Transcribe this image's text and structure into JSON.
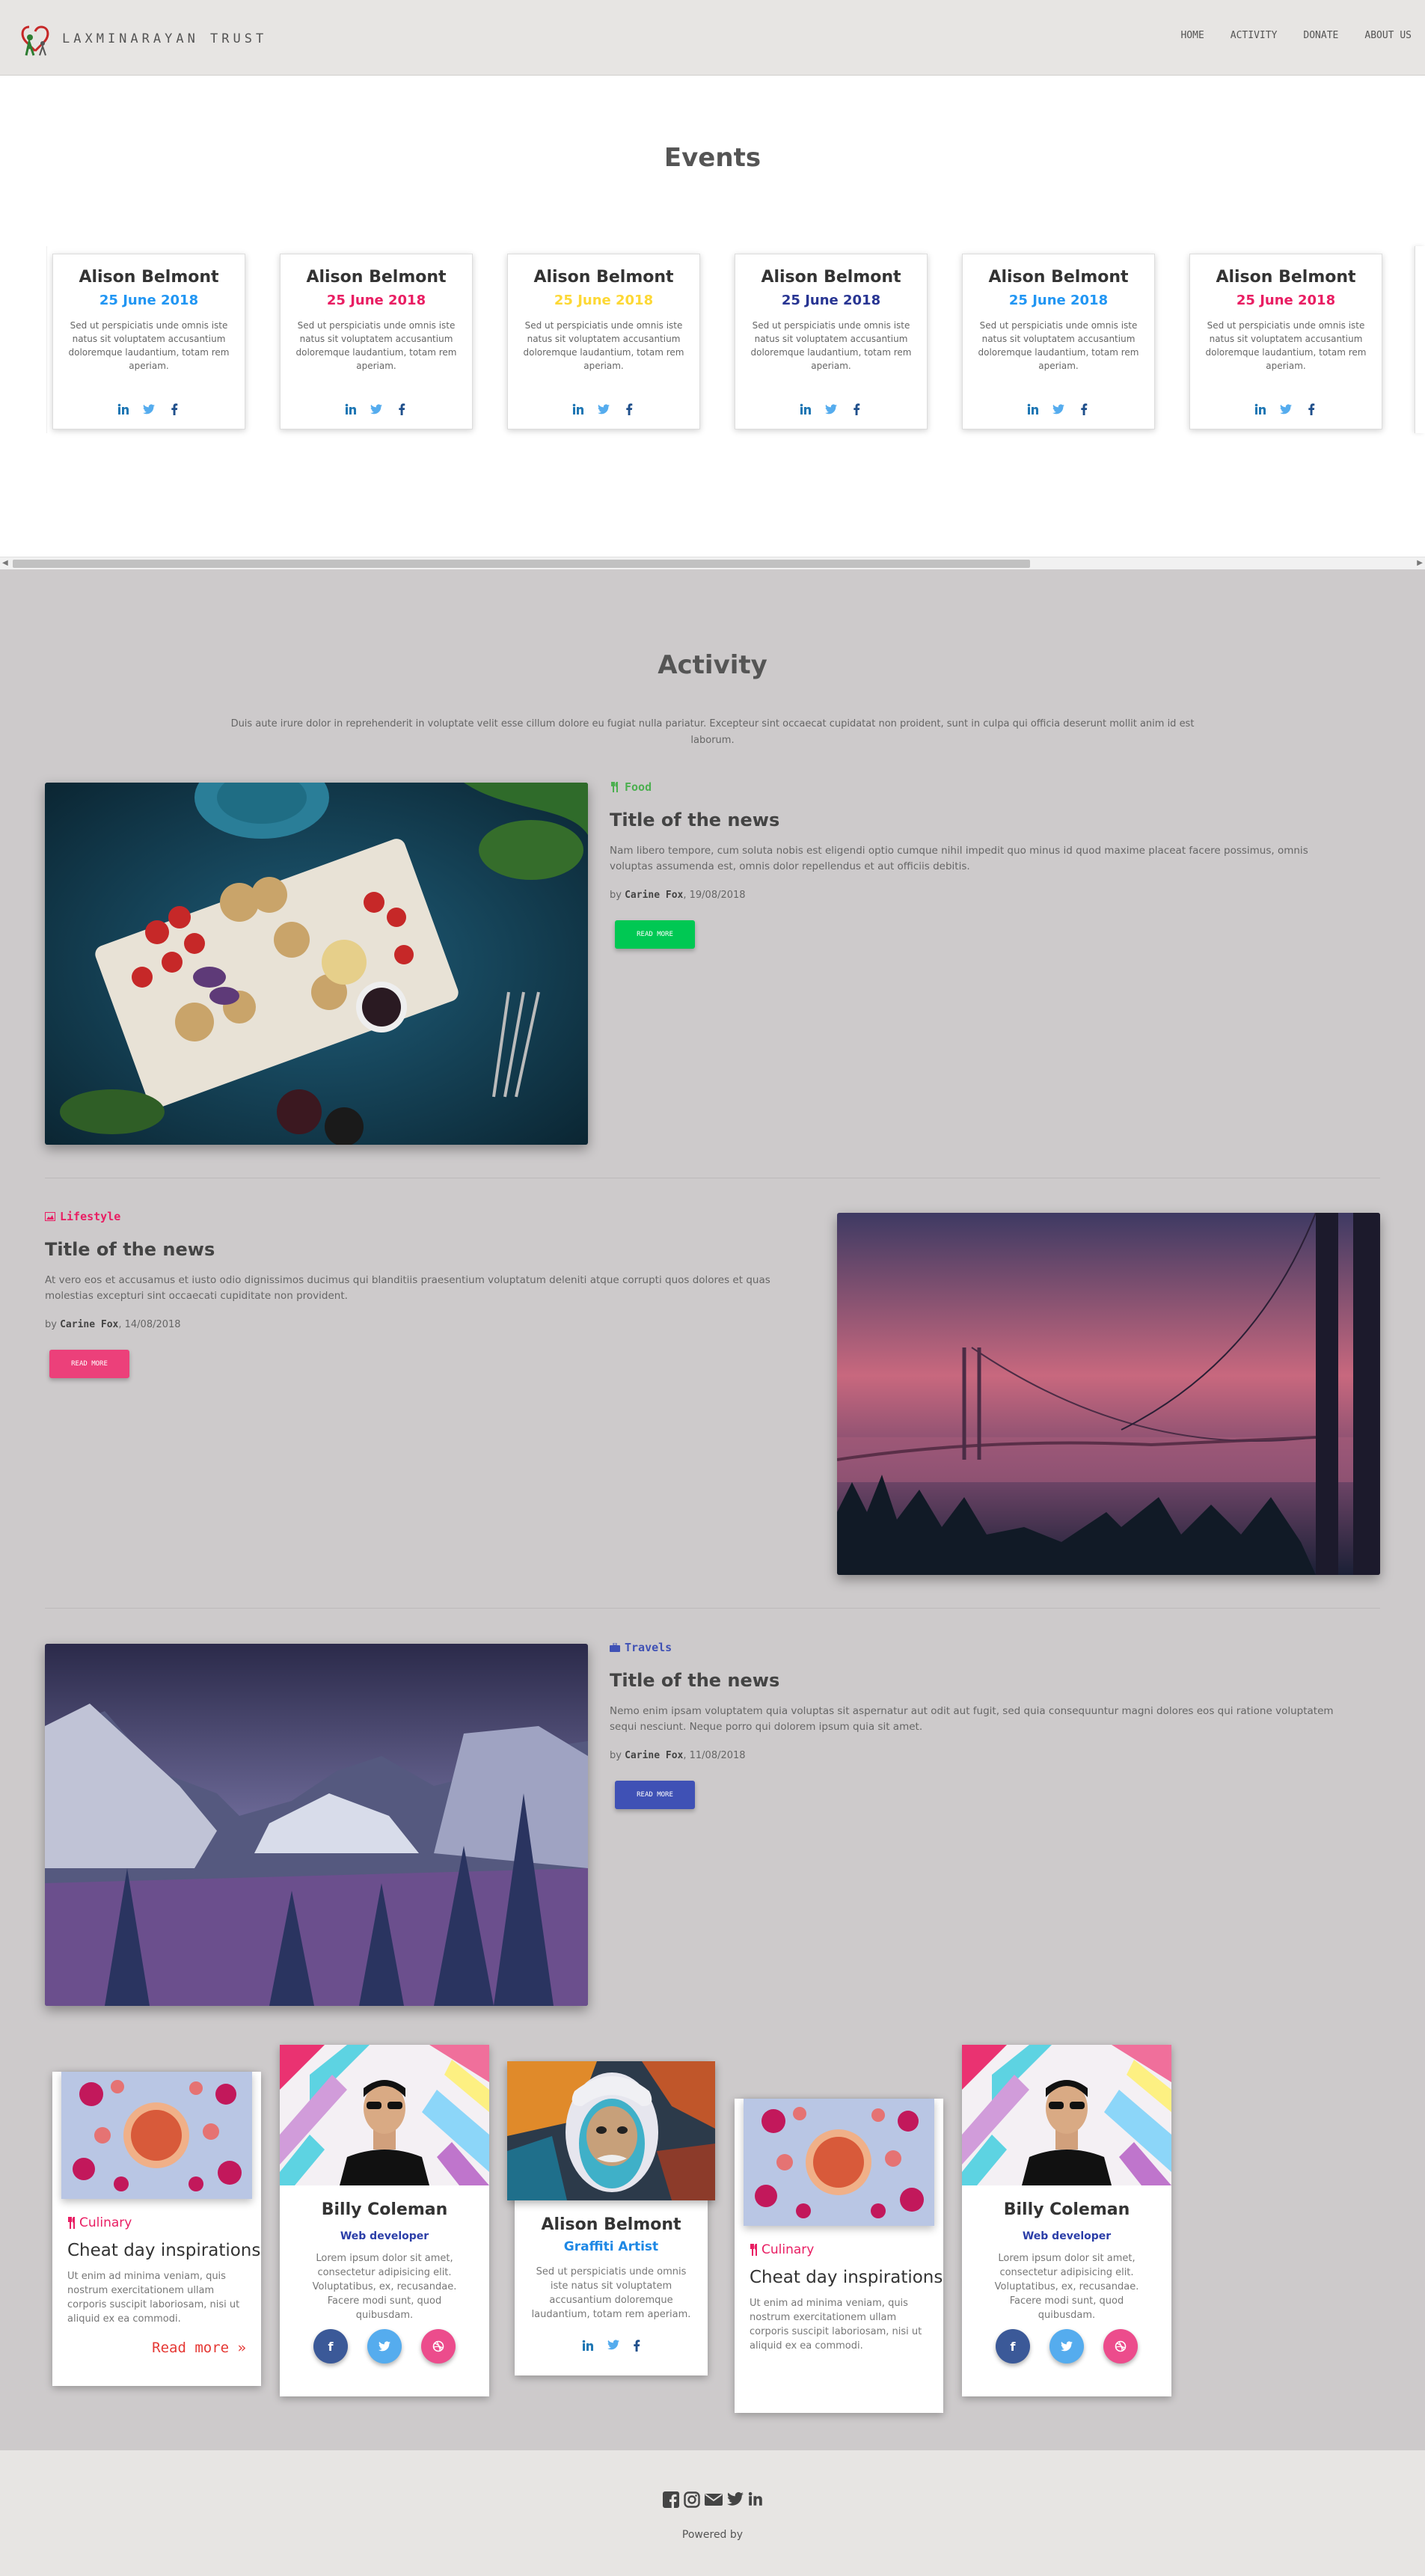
{
  "nav": {
    "brand": "LAXMINARAYAN TRUST",
    "menu": [
      "HOME",
      "ACTIVITY",
      "DONATE",
      "ABOUT US"
    ]
  },
  "events": {
    "title": "Events",
    "cards": [
      {
        "name": "Alison Belmont",
        "date": "25 June 2018",
        "date_color": "#2196f3",
        "text": "Sed ut perspiciatis unde omnis iste natus sit voluptatem accusantium doloremque laudantium, totam rem aperiam."
      },
      {
        "name": "Alison Belmont",
        "date": "25 June 2018",
        "date_color": "#e91e63",
        "text": "Sed ut perspiciatis unde omnis iste natus sit voluptatem accusantium doloremque laudantium, totam rem aperiam."
      },
      {
        "name": "Alison Belmont",
        "date": "25 June 2018",
        "date_color": "#fdd835",
        "text": "Sed ut perspiciatis unde omnis iste natus sit voluptatem accusantium doloremque laudantium, totam rem aperiam."
      },
      {
        "name": "Alison Belmont",
        "date": "25 June 2018",
        "date_color": "#283593",
        "text": "Sed ut perspiciatis unde omnis iste natus sit voluptatem accusantium doloremque laudantium, totam rem aperiam."
      },
      {
        "name": "Alison Belmont",
        "date": "25 June 2018",
        "date_color": "#2196f3",
        "text": "Sed ut perspiciatis unde omnis iste natus sit voluptatem accusantium doloremque laudantium, totam rem aperiam."
      },
      {
        "name": "Alison Belmont",
        "date": "25 June 2018",
        "date_color": "#e91e63",
        "text": "Sed ut perspiciatis unde omnis iste natus sit voluptatem accusantium doloremque laudantium, totam rem aperiam."
      }
    ],
    "social_icons": [
      "linkedin-icon",
      "twitter-icon",
      "facebook-icon"
    ]
  },
  "activity": {
    "title": "Activity",
    "lead": "Duis aute irure dolor in reprehenderit in voluptate velit esse cillum dolore eu fugiat nulla pariatur. Excepteur sint occaecat cupidatat non proident, sunt in culpa qui officia deserunt mollit anim id est laborum.",
    "news": [
      {
        "category": "Food",
        "category_color": "#4caf50",
        "title": "Title of the news",
        "text": "Nam libero tempore, cum soluta nobis est eligendi optio cumque nihil impedit quo minus id quod maxime placeat facere possimus, omnis voluptas assumenda est, omnis dolor repellendus et aut officiis debitis.",
        "by": "by",
        "author": "Carine Fox",
        "date": ", 19/08/2018",
        "button": "READ MORE",
        "button_color": "#00c853"
      },
      {
        "category": "Lifestyle",
        "category_color": "#e91e63",
        "title": "Title of the news",
        "text": "At vero eos et accusamus et iusto odio dignissimos ducimus qui blanditiis praesentium voluptatum deleniti atque corrupti quos dolores et quas molestias excepturi sint occaecati cupiditate non provident.",
        "by": "by",
        "author": "Carine Fox",
        "date": ", 14/08/2018",
        "button": "READ MORE",
        "button_color": "#ec407a"
      },
      {
        "category": "Travels",
        "category_color": "#3f51b5",
        "title": "Title of the news",
        "text": "Nemo enim ipsam voluptatem quia voluptas sit aspernatur aut odit aut fugit, sed quia consequuntur magni dolores eos qui ratione voluptatem sequi nesciunt. Neque porro qui dolorem ipsum quia sit amet.",
        "by": "by",
        "author": "Carine Fox",
        "date": ", 11/08/2018",
        "button": "READ MORE",
        "button_color": "#3f51b5"
      }
    ]
  },
  "cards": {
    "culinary1": {
      "category": "Culinary",
      "title": "Cheat day inspirations",
      "text": "Ut enim ad minima veniam, quis nostrum exercitationem ullam corporis suscipit laboriosam, nisi ut aliquid ex ea commodi.",
      "read_more": "Read more"
    },
    "profile1": {
      "name": "Billy Coleman",
      "role": "Web developer",
      "text": "Lorem ipsum dolor sit amet, consectetur adipisicing elit. Voluptatibus, ex, recusandae. Facere modi sunt, quod quibusdam."
    },
    "artist": {
      "name": "Alison Belmont",
      "role": "Graffiti Artist",
      "text": "Sed ut perspiciatis unde omnis iste natus sit voluptatem accusantium doloremque laudantium, totam rem aperiam."
    },
    "culinary2": {
      "category": "Culinary",
      "title": "Cheat day inspirations",
      "text": "Ut enim ad minima veniam, quis nostrum exercitationem ullam corporis suscipit laboriosam, nisi ut aliquid ex ea commodi."
    },
    "profile2": {
      "name": "Billy Coleman",
      "role": "Web developer",
      "text": "Lorem ipsum dolor sit amet, consectetur adipisicing elit. Voluptatibus, ex, recusandae. Facere modi sunt, quod quibusdam."
    }
  },
  "footer": {
    "icons": [
      "facebook-icon",
      "instagram-icon",
      "envelope-icon",
      "twitter-icon",
      "linkedin-icon"
    ],
    "powered": "Powered by"
  },
  "colors": {
    "facebook": "#3b5998",
    "twitter": "#55acee",
    "dribbble": "#ec4c8c",
    "linkedin": "#0e76a8",
    "icon_blue": "#1f77b4"
  }
}
